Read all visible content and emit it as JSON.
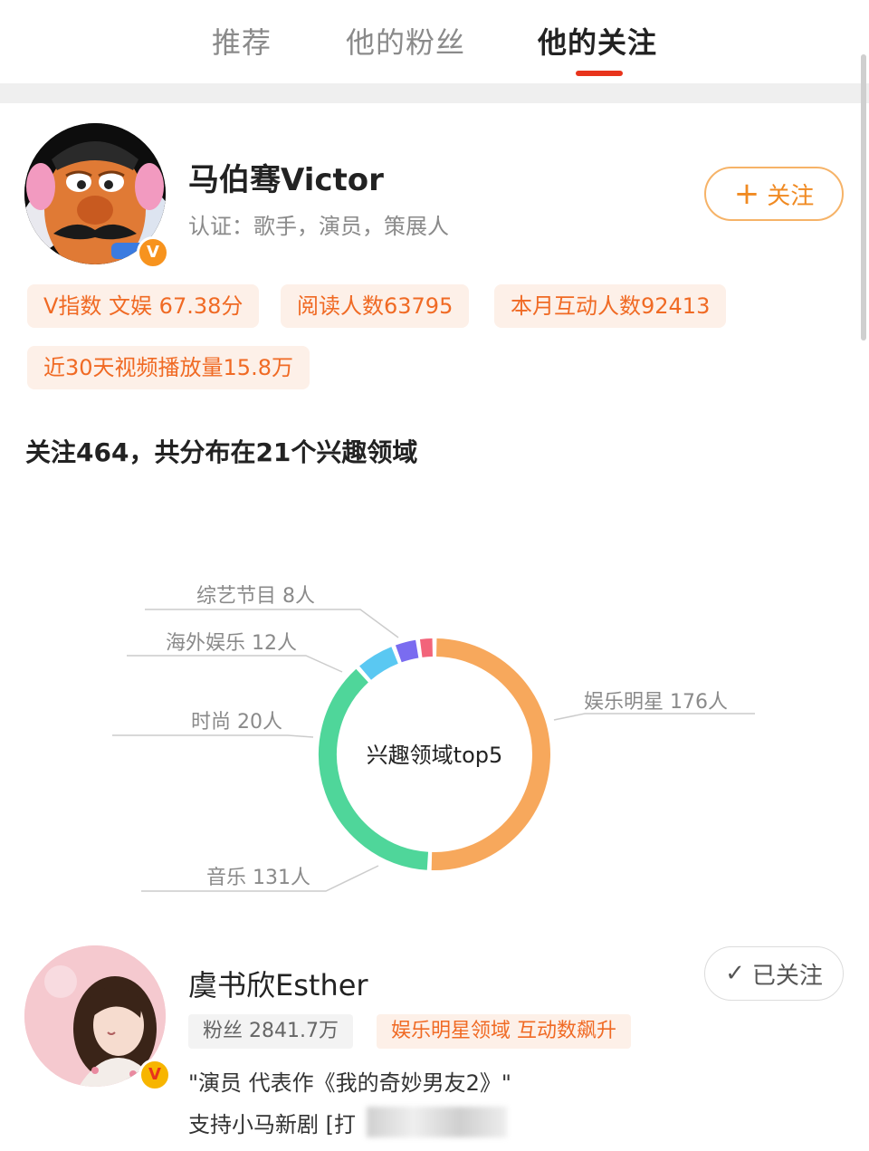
{
  "tabs": [
    {
      "label": "推荐"
    },
    {
      "label": "他的粉丝"
    },
    {
      "label": "他的关注"
    }
  ],
  "profile": {
    "name": "马伯骞Victor",
    "verification": "认证：歌手，演员，策展人",
    "verified_badge": "V",
    "follow_button": "关注",
    "tags": [
      "V指数 文娱 67.38分",
      "阅读人数63795",
      "本月互动人数92413",
      "近30天视频播放量15.8万"
    ]
  },
  "summary": "关注464，共分布在21个兴趣领域",
  "chart_data": {
    "type": "pie",
    "title": "兴趣领域top5",
    "slices": [
      {
        "label": "娱乐明星 176人",
        "value": 176,
        "color": "#f7a85c"
      },
      {
        "label": "音乐 131人",
        "value": 131,
        "color": "#4fd69a"
      },
      {
        "label": "时尚 20人",
        "value": 20,
        "color": "#5ac8f2"
      },
      {
        "label": "海外娱乐 12人",
        "value": 12,
        "color": "#7a6cf0"
      },
      {
        "label": "综艺节目 8人",
        "value": 8,
        "color": "#f2647a"
      }
    ]
  },
  "followed_user": {
    "name": "虞书欣Esther",
    "followed_button": "已关注",
    "verified_badge": "V",
    "fans": "粉丝 2841.7万",
    "trend_tag": "娱乐明星领域 互动数飙升",
    "desc_line1": "\"演员 代表作《我的奇妙男友2》\"",
    "desc_line2": "支持小马新剧 [打"
  },
  "colors": {
    "accent": "#f06a24",
    "tab_indicator": "#e8341c"
  }
}
